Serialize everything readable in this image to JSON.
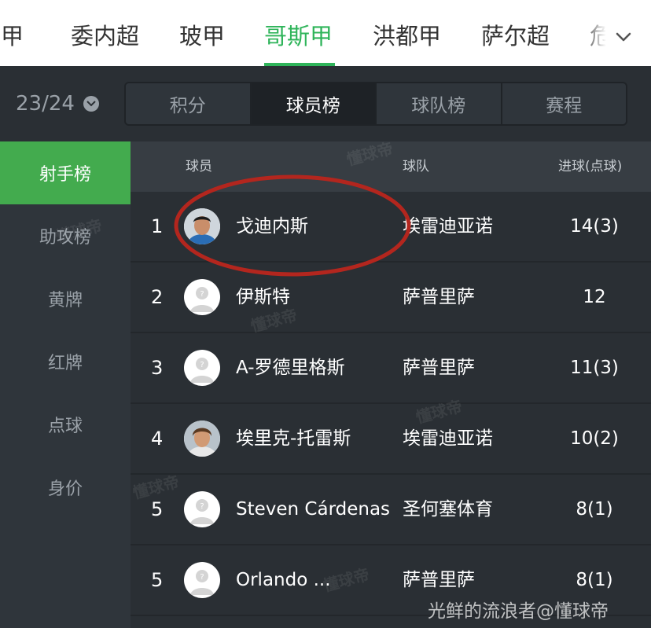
{
  "league_tabs": [
    {
      "label": "西甲",
      "active": false
    },
    {
      "label": "委内超",
      "active": false
    },
    {
      "label": "玻甲",
      "active": false
    },
    {
      "label": "哥斯甲",
      "active": true
    },
    {
      "label": "洪都甲",
      "active": false
    },
    {
      "label": "萨尔超",
      "active": false
    },
    {
      "label": "危",
      "active": false
    }
  ],
  "season": {
    "label": "23/24"
  },
  "segments": [
    {
      "label": "积分",
      "active": false
    },
    {
      "label": "球员榜",
      "active": true
    },
    {
      "label": "球队榜",
      "active": false
    },
    {
      "label": "赛程",
      "active": false
    }
  ],
  "sidebar": {
    "items": [
      {
        "label": "射手榜",
        "active": true
      },
      {
        "label": "助攻榜",
        "active": false
      },
      {
        "label": "黄牌",
        "active": false
      },
      {
        "label": "红牌",
        "active": false
      },
      {
        "label": "点球",
        "active": false
      },
      {
        "label": "身价",
        "active": false
      }
    ]
  },
  "table": {
    "headers": {
      "player": "球员",
      "team": "球队",
      "goals": "进球(点球)"
    },
    "rows": [
      {
        "rank": "1",
        "player": "戈迪内斯",
        "team": "埃雷迪亚诺",
        "goals": "14(3)",
        "avatar": "player-photo"
      },
      {
        "rank": "2",
        "player": "伊斯特",
        "team": "萨普里萨",
        "goals": "12",
        "avatar": "placeholder"
      },
      {
        "rank": "3",
        "player": "A-罗德里格斯",
        "team": "萨普里萨",
        "goals": "11(3)",
        "avatar": "placeholder"
      },
      {
        "rank": "4",
        "player": "埃里克-托雷斯",
        "team": "埃雷迪亚诺",
        "goals": "10(2)",
        "avatar": "player-photo"
      },
      {
        "rank": "5",
        "player": "Steven Cárdenas",
        "team": "圣何塞体育",
        "goals": "8(1)",
        "avatar": "placeholder"
      },
      {
        "rank": "5",
        "player": "Orlando ...",
        "team": "萨普里萨",
        "goals": "8(1)",
        "avatar": "placeholder"
      }
    ]
  },
  "watermark": "懂球帝",
  "credit": "光鲜的流浪者@懂球帝",
  "colors": {
    "accent": "#2fb45a",
    "sidebar_active": "#43ab4e",
    "highlight_circle": "#b3261e"
  }
}
